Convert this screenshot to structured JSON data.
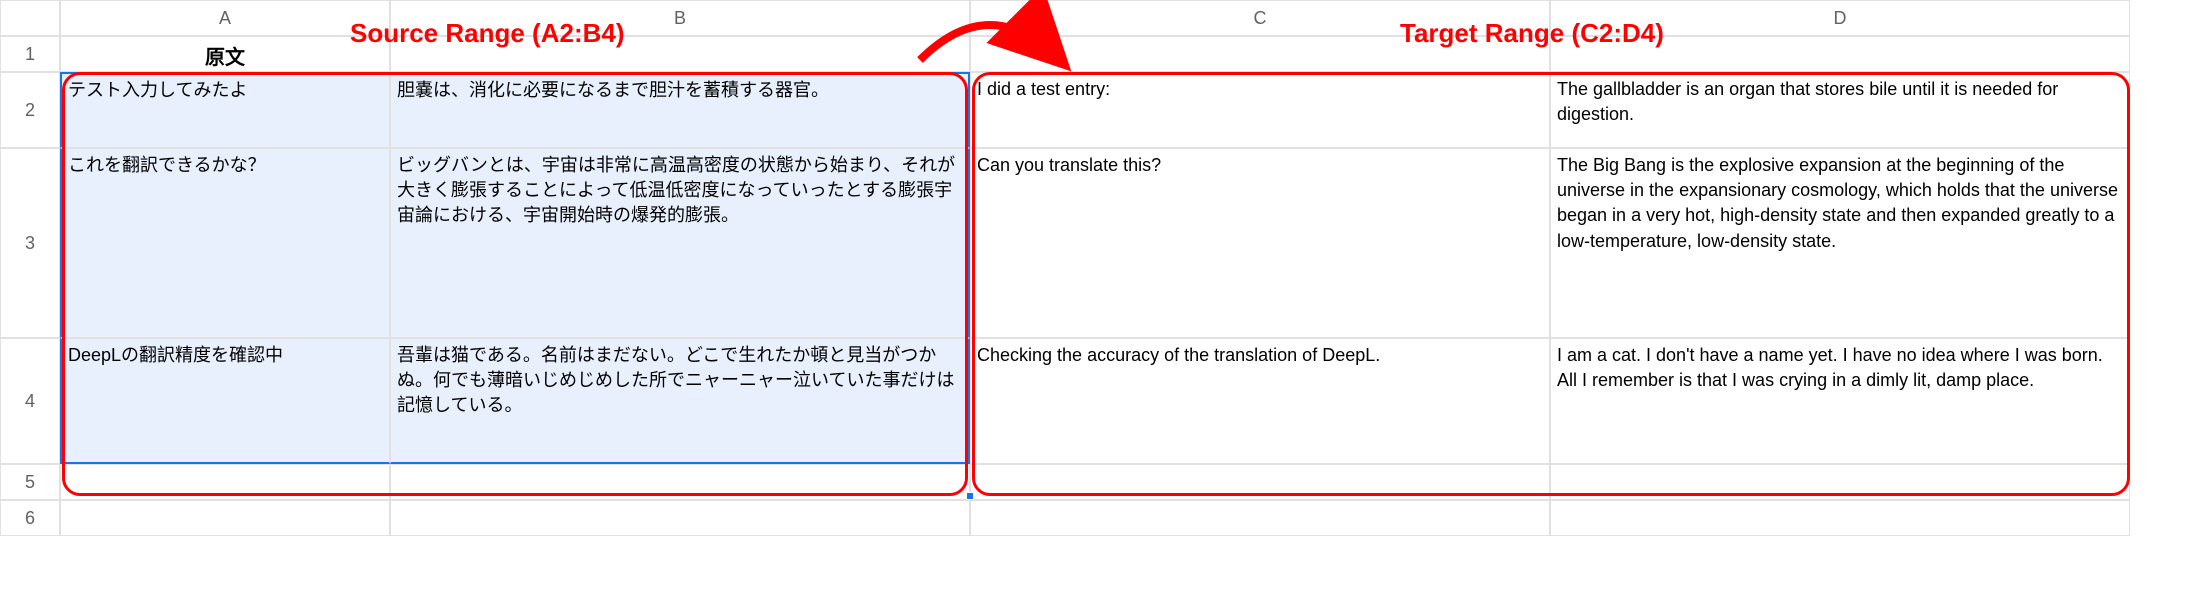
{
  "annotations": {
    "source_label": "Source Range (A2:B4)",
    "target_label": "Target Range (C2:D4)"
  },
  "columns": [
    "A",
    "B",
    "C",
    "D"
  ],
  "row_numbers": [
    "1",
    "2",
    "3",
    "4",
    "5",
    "6"
  ],
  "header_row": {
    "A": "原文",
    "B": "",
    "C": "",
    "D": ""
  },
  "data": [
    {
      "A": "テスト入力してみたよ",
      "B": "胆嚢は、消化に必要になるまで胆汁を蓄積する器官。",
      "C": "I did a test entry:",
      "D": " The gallbladder is an organ that stores bile until it is needed for digestion."
    },
    {
      "A": "これを翻訳できるかな？",
      "B": "ビッグバンとは、宇宙は非常に高温高密度の状態から始まり、それが大きく膨張することによって低温低密度になっていったとする膨張宇宙論における、宇宙開始時の爆発的膨張。",
      "C": "Can you translate this?",
      "D": "The Big Bang is the explosive expansion at the beginning of the universe in the expansionary cosmology, which holds that the universe began in a very hot, high-density state and then expanded greatly to a low-temperature, low-density state."
    },
    {
      "A": "DeepLの翻訳精度を確認中",
      "B": "吾輩は猫である。名前はまだない。どこで生れたか頓と見当がつかぬ。何でも薄暗いじめじめした所でニャーニャー泣いていた事だけは記憶している。",
      "C": "Checking the accuracy of the translation of DeepL.",
      "D": " I am a cat. I don't have a name yet. I have no idea where I was born. All I remember is that I was crying in a dimly lit, damp place."
    }
  ]
}
